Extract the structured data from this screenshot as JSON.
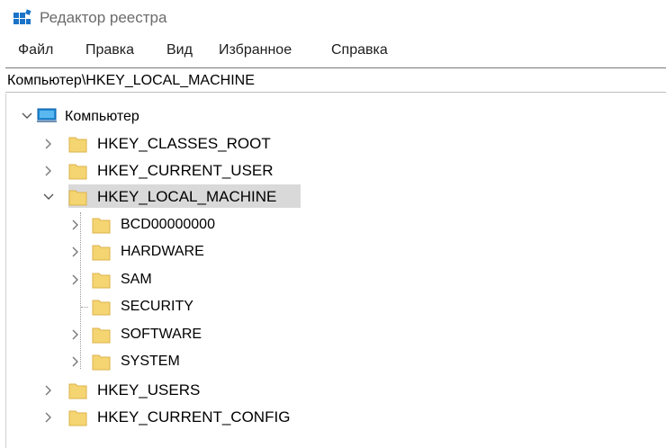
{
  "window": {
    "title": "Редактор реестра"
  },
  "menu": [
    "Файл",
    "Правка",
    "Вид",
    "Избранное",
    "Справка"
  ],
  "address": "Компьютер\\HKEY_LOCAL_MACHINE",
  "tree": {
    "root": {
      "label": "Компьютер",
      "expanded": true
    },
    "hives": [
      {
        "label": "HKEY_CLASSES_ROOT",
        "expanded": false
      },
      {
        "label": "HKEY_CURRENT_USER",
        "expanded": false
      },
      {
        "label": "HKEY_LOCAL_MACHINE",
        "expanded": true,
        "selected": true
      },
      {
        "label": "HKEY_USERS",
        "expanded": false
      },
      {
        "label": "HKEY_CURRENT_CONFIG",
        "expanded": false
      }
    ],
    "hklm_children": [
      {
        "label": "BCD00000000",
        "has_children": true
      },
      {
        "label": "HARDWARE",
        "has_children": true
      },
      {
        "label": "SAM",
        "has_children": true
      },
      {
        "label": "SECURITY",
        "has_children": false
      },
      {
        "label": "SOFTWARE",
        "has_children": true
      },
      {
        "label": "SYSTEM",
        "has_children": true
      }
    ]
  },
  "colors": {
    "folder": "#f5d572",
    "folder_edge": "#dcb24a",
    "selection": "#d9d9d9",
    "monitor": "#1f8ad6"
  }
}
